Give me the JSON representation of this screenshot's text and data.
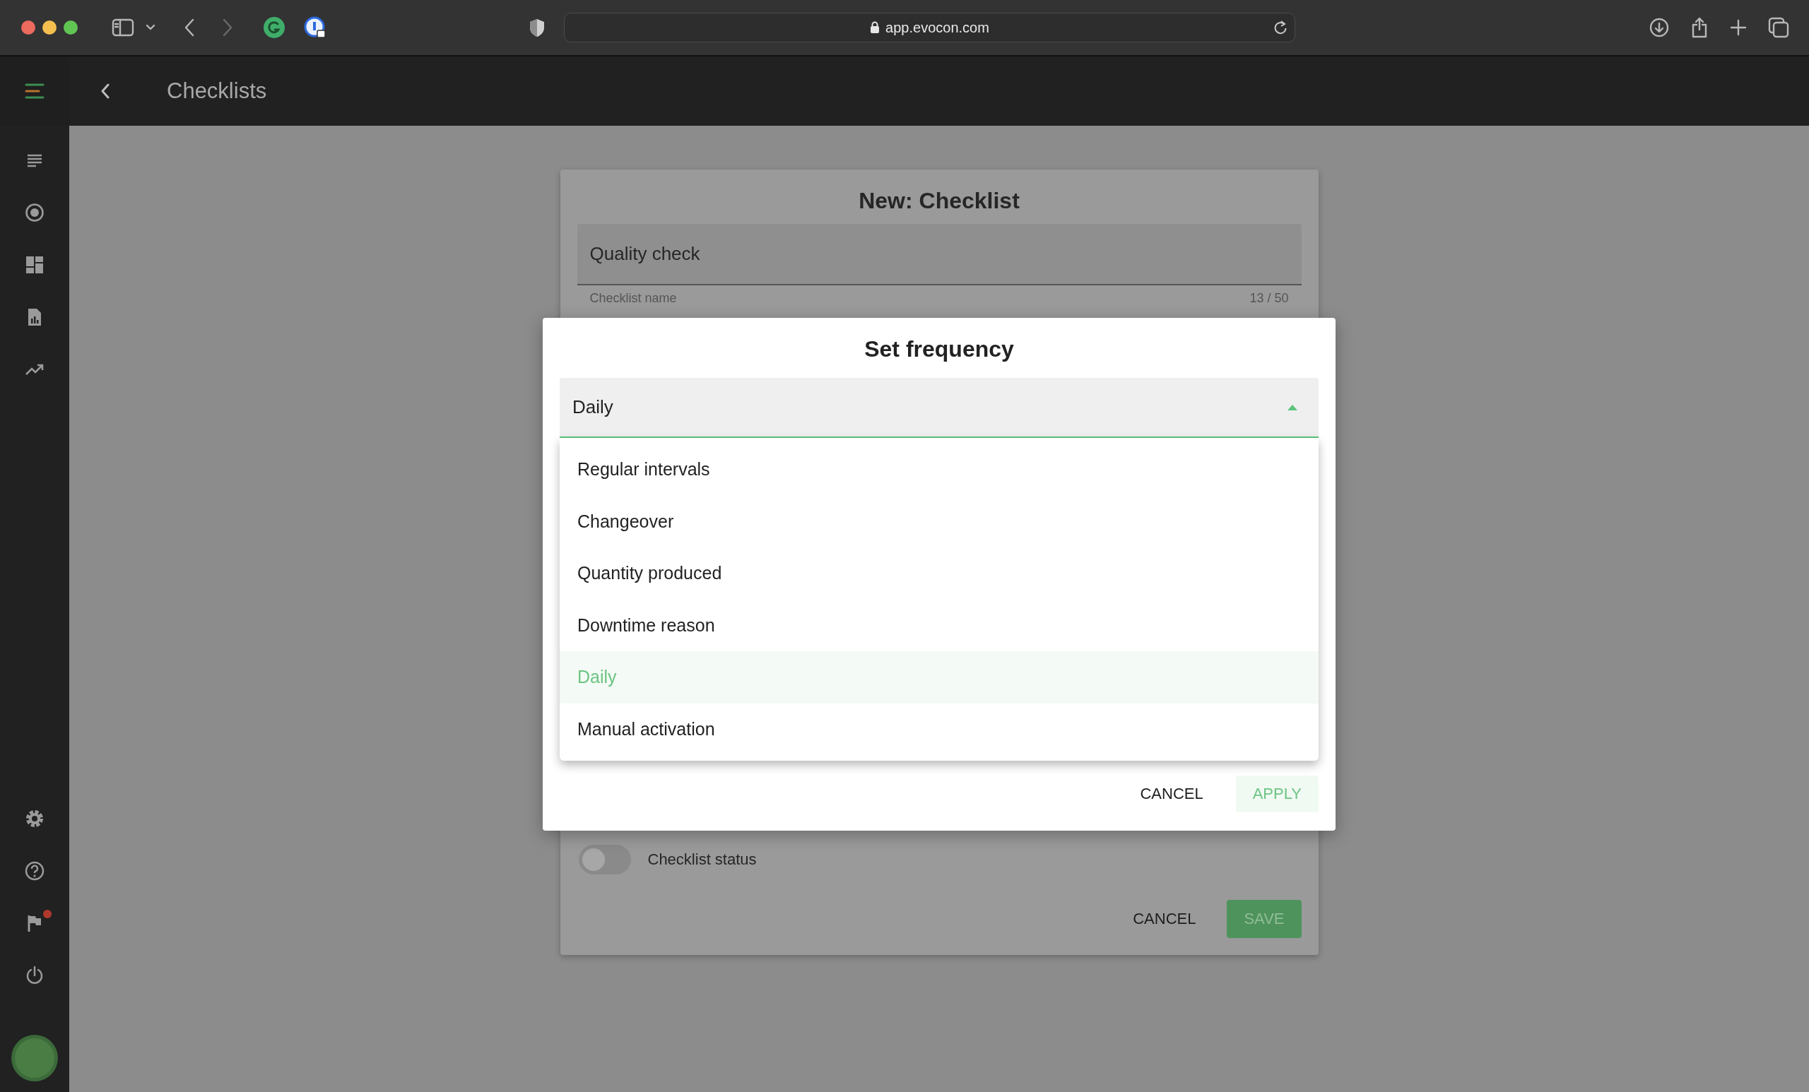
{
  "browser": {
    "url": "app.evocon.com"
  },
  "app_header": {
    "title": "Checklists"
  },
  "sidebar": {
    "items": [
      {
        "kind": "list",
        "badge": false
      },
      {
        "kind": "target",
        "badge": false
      },
      {
        "kind": "dashboard",
        "badge": false
      },
      {
        "kind": "report",
        "badge": false
      },
      {
        "kind": "trend",
        "badge": false
      }
    ],
    "footer_items": [
      {
        "kind": "settings",
        "badge": false
      },
      {
        "kind": "help",
        "badge": false
      },
      {
        "kind": "flag",
        "badge": true
      },
      {
        "kind": "power",
        "badge": false
      }
    ]
  },
  "checklist_form": {
    "title": "New: Checklist",
    "name_field": {
      "value": "Quality check",
      "label": "Checklist name",
      "counter": "13 / 50"
    },
    "status_toggle": {
      "label": "Checklist status",
      "on": false
    },
    "buttons": [
      {
        "label": "CANCEL",
        "kind": "text"
      },
      {
        "label": "SAVE",
        "kind": "primary"
      }
    ]
  },
  "frequency_dialog": {
    "title": "Set frequency",
    "select": {
      "value": "Daily",
      "expanded": true
    },
    "options": [
      {
        "label": "Regular intervals",
        "selected": false
      },
      {
        "label": "Changeover",
        "selected": false
      },
      {
        "label": "Quantity produced",
        "selected": false
      },
      {
        "label": "Downtime reason",
        "selected": false
      },
      {
        "label": "Daily",
        "selected": true
      },
      {
        "label": "Manual activation",
        "selected": false
      }
    ],
    "buttons": [
      {
        "label": "CANCEL",
        "kind": "text"
      },
      {
        "label": "APPLY",
        "kind": "accent"
      }
    ]
  }
}
